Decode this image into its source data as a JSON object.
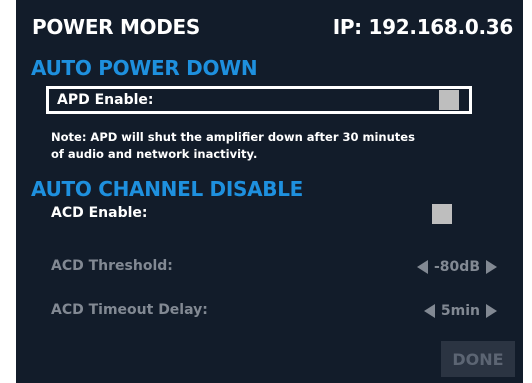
{
  "header": {
    "title": "POWER MODES",
    "ip": "IP: 192.168.0.36"
  },
  "auto_power_down": {
    "heading": "AUTO POWER DOWN",
    "apd_enable_label": "APD Enable:",
    "apd_enabled": false,
    "note": "Note: APD will shut the amplifier down after 30 minutes of audio and network inactivity."
  },
  "auto_channel_disable": {
    "heading": "AUTO CHANNEL DISABLE",
    "acd_enable_label": "ACD Enable:",
    "acd_enabled": false,
    "threshold": {
      "label": "ACD Threshold:",
      "value": "-80dB",
      "decrease_icon": "left-arrow-icon",
      "increase_icon": "right-arrow-icon"
    },
    "timeout": {
      "label": "ACD Timeout Delay:",
      "value": "5min",
      "decrease_icon": "left-arrow-icon",
      "increase_icon": "right-arrow-icon"
    }
  },
  "footer": {
    "done_label": "DONE"
  },
  "colors": {
    "background": "#121c2a",
    "accent": "#1e90de",
    "text": "#ffffff",
    "disabled_text": "#828993",
    "checkbox": "#bebebe",
    "done_button_bg": "#2b3442",
    "done_button_text": "#5c6573"
  }
}
